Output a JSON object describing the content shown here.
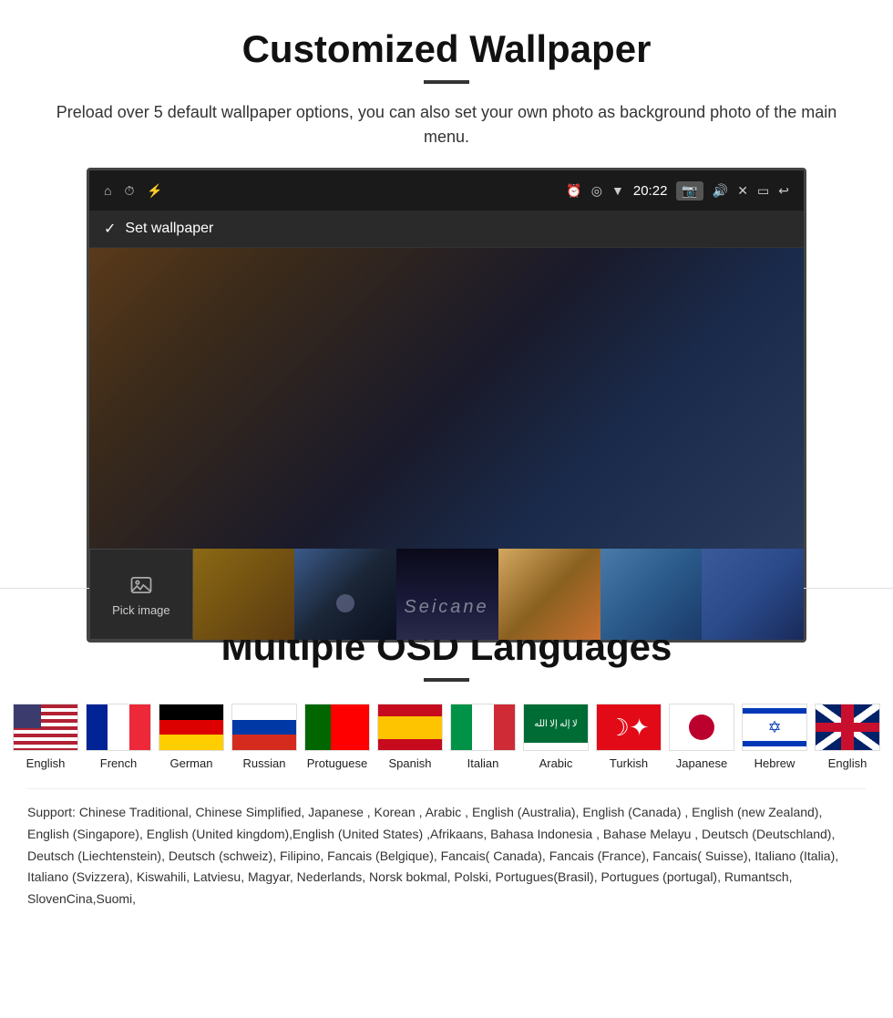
{
  "wallpaper_section": {
    "title": "Customized Wallpaper",
    "subtitle": "Preload over 5 default wallpaper options, you can also set your own photo as background photo of the main menu.",
    "device": {
      "time": "20:22",
      "toolbar_label": "Set wallpaper",
      "pick_image_label": "Pick image",
      "watermark": "Seicane"
    }
  },
  "languages_section": {
    "title": "Multiple OSD Languages",
    "flags": [
      {
        "name": "English",
        "type": "usa"
      },
      {
        "name": "French",
        "type": "france"
      },
      {
        "name": "German",
        "type": "germany"
      },
      {
        "name": "Russian",
        "type": "russia"
      },
      {
        "name": "Protuguese",
        "type": "portugal"
      },
      {
        "name": "Spanish",
        "type": "spain"
      },
      {
        "name": "Italian",
        "type": "italy"
      },
      {
        "name": "Arabic",
        "type": "arabic"
      },
      {
        "name": "Turkish",
        "type": "turkey"
      },
      {
        "name": "Japanese",
        "type": "japan"
      },
      {
        "name": "Hebrew",
        "type": "israel"
      },
      {
        "name": "English",
        "type": "uk"
      }
    ],
    "support_text": "Support: Chinese Traditional, Chinese Simplified, Japanese , Korean , Arabic , English (Australia), English (Canada) , English (new Zealand), English (Singapore), English (United kingdom),English (United States) ,Afrikaans, Bahasa Indonesia , Bahase Melayu , Deutsch (Deutschland), Deutsch (Liechtenstein), Deutsch (schweiz), Filipino, Fancais (Belgique), Fancais( Canada), Fancais (France), Fancais( Suisse), Italiano (Italia), Italiano (Svizzera), Kiswahili, Latviesu, Magyar, Nederlands, Norsk bokmal, Polski, Portugues(Brasil), Portugues (portugal), Rumantsch, SlovenCina,Suomi,"
  }
}
